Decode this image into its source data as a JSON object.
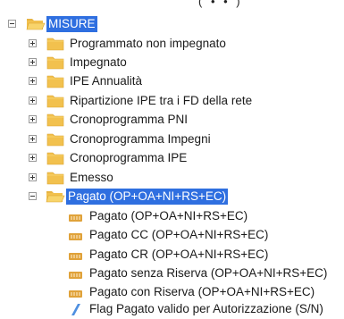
{
  "top_fragment": "( • • )",
  "root": {
    "label": "MISURE",
    "expanded": true,
    "selected": true,
    "icon": "folder-open-icon"
  },
  "folders": [
    {
      "label": "Programmato non impegnato",
      "expanded": false
    },
    {
      "label": "Impegnato",
      "expanded": false
    },
    {
      "label": "IPE Annualità",
      "expanded": false
    },
    {
      "label": "Ripartizione IPE tra i FD della rete",
      "expanded": false
    },
    {
      "label": "Cronoprogramma PNI",
      "expanded": false
    },
    {
      "label": "Cronoprogramma Impegni",
      "expanded": false
    },
    {
      "label": "Cronoprogramma IPE",
      "expanded": false
    },
    {
      "label": "Emesso",
      "expanded": false
    },
    {
      "label": "Pagato (OP+OA+NI+RS+EC)",
      "expanded": true,
      "selected": true
    }
  ],
  "measures": [
    {
      "label": "Pagato (OP+OA+NI+RS+EC)",
      "icon": "measure-icon"
    },
    {
      "label": "Pagato CC (OP+OA+NI+RS+EC)",
      "icon": "measure-icon"
    },
    {
      "label": "Pagato CR (OP+OA+NI+RS+EC)",
      "icon": "measure-icon"
    },
    {
      "label": "Pagato senza Riserva (OP+OA+NI+RS+EC)",
      "icon": "measure-icon"
    },
    {
      "label": "Pagato con Riserva (OP+OA+NI+RS+EC)",
      "icon": "measure-icon"
    },
    {
      "label": "Flag Pagato valido per Autorizzazione (S/N)",
      "icon": "flag-attribute-icon"
    }
  ],
  "colors": {
    "selection": "#2f6fe0",
    "folder": "#f2c14e",
    "folder_dark": "#d9a22c",
    "measure": "#e0a23a",
    "flag": "#4e8fe0"
  }
}
